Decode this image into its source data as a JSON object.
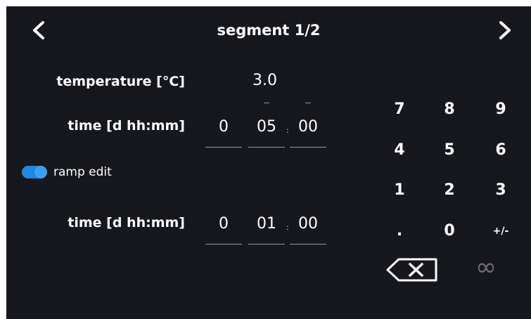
{
  "header": {
    "title": "segment 1/2",
    "prev_icon": "chevron-left-icon",
    "next_icon": "chevron-right-icon"
  },
  "temperature": {
    "label": "temperature [°C]",
    "value": "3.0"
  },
  "time1": {
    "label": "time [d hh:mm]",
    "days": "0",
    "hours": "05",
    "minutes": "00",
    "separator": ":"
  },
  "ramp": {
    "label": "ramp edit",
    "enabled": true,
    "toggle_color": "#1e88e5"
  },
  "time2": {
    "label": "time [d hh:mm]",
    "days": "0",
    "hours": "01",
    "minutes": "00",
    "separator": ":"
  },
  "keypad": {
    "keys": [
      "7",
      "8",
      "9",
      "4",
      "5",
      "6",
      "1",
      "2",
      "3",
      ".",
      "0",
      "+/-"
    ],
    "backspace_icon": "backspace-icon",
    "infinity": "∞"
  },
  "colors": {
    "background": "#17181d",
    "text": "#ffffff",
    "accent": "#1e88e5",
    "disabled": "#6e6e74"
  }
}
